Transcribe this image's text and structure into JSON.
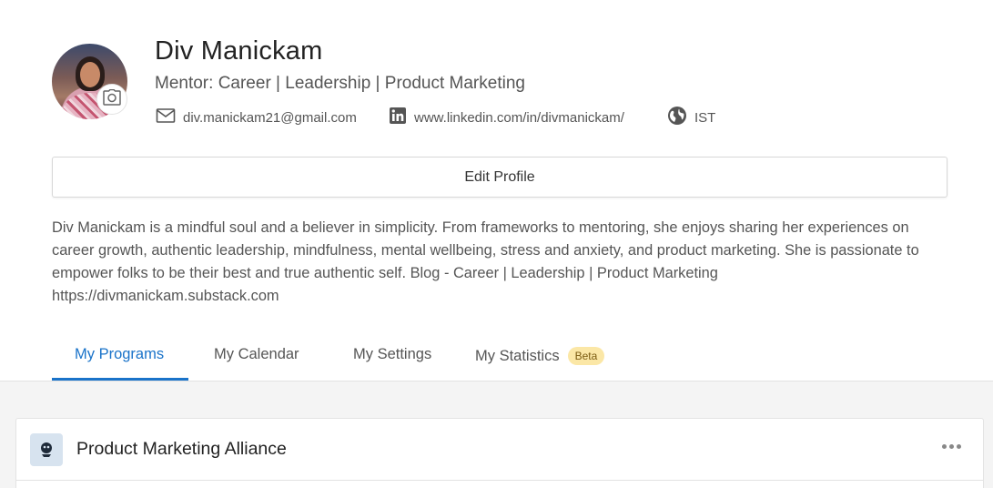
{
  "profile": {
    "name": "Div Manickam",
    "title": "Mentor: Career | Leadership | Product Marketing",
    "email": "div.manickam21@gmail.com",
    "linkedin": "www.linkedin.com/in/divmanickam/",
    "timezone": "IST",
    "avatar_icon": "camera-icon"
  },
  "actions": {
    "edit_profile_label": "Edit Profile"
  },
  "bio": "Div Manickam is a mindful soul and a believer in simplicity. From frameworks to mentoring, she enjoys sharing her experiences on career growth, authentic leadership, mindfulness, mental wellbeing, stress and anxiety, and product marketing. She is passionate to empower folks to be their best and true authentic self. Blog - Career | Leadership | Product Marketing https://divmanickam.substack.com",
  "tabs": [
    {
      "label": "My Programs",
      "active": true
    },
    {
      "label": "My Calendar",
      "active": false
    },
    {
      "label": "My Settings",
      "active": false
    },
    {
      "label": "My Statistics",
      "active": false,
      "badge": "Beta"
    }
  ],
  "programs": [
    {
      "title": "Product Marketing Alliance",
      "menu_icon": "more-horizontal-icon"
    }
  ],
  "colors": {
    "accent": "#1a73c9",
    "beta_badge_bg": "#fbe7a6",
    "content_bg": "#f4f4f4"
  }
}
